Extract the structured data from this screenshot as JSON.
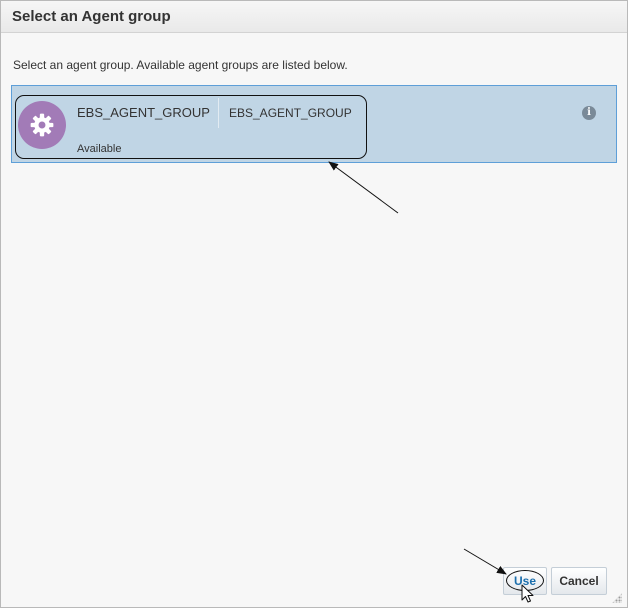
{
  "dialog": {
    "title": "Select an Agent group",
    "instructions": "Select an agent group. Available agent groups are listed below."
  },
  "agent_groups": [
    {
      "name": "EBS_AGENT_GROUP",
      "description": "EBS_AGENT_GROUP",
      "status": "Available",
      "icon": "gear-icon",
      "selected": true
    }
  ],
  "buttons": {
    "use_label": "Use",
    "cancel_label": "Cancel"
  },
  "colors": {
    "selection_bg": "#c0d5e5",
    "selection_border": "#5e9fd8",
    "avatar": "#a27bb7",
    "primary_text": "#1c6fad"
  }
}
